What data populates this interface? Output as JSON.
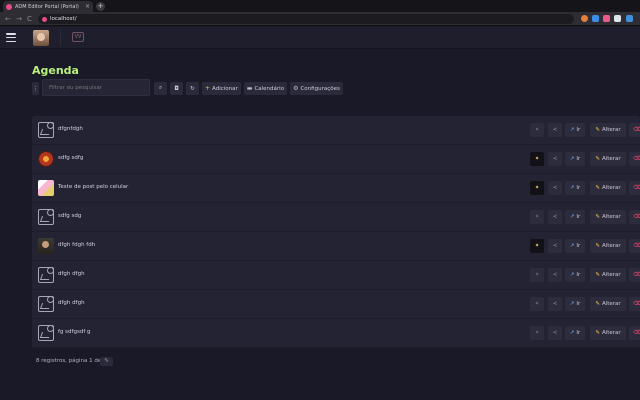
{
  "browser": {
    "tab_title": "ADM Editor Portal (Portal)",
    "tab_close": "×",
    "new_tab": "+",
    "url": "localhost/",
    "back": "←",
    "forward": "→",
    "reload": "C"
  },
  "appbar": {
    "logo_text": "VV"
  },
  "page": {
    "title": "Agenda"
  },
  "filters": {
    "search_placeholder": "Filtrar ou pesquisar",
    "add_label": "Adicionar",
    "calendar_label": "Calendário",
    "settings_label": "Configurações"
  },
  "actions": {
    "go_label": "Ir",
    "edit_label": "Alterar"
  },
  "rows": [
    {
      "title": "dfgnfdgh",
      "thumb": "placeholder",
      "pinned": false
    },
    {
      "title": "sdfg sdfg",
      "thumb": "img-red",
      "pinned": true
    },
    {
      "title": "Teste de post pelo celular",
      "thumb": "img-pink",
      "pinned": true
    },
    {
      "title": "sdfg sdg",
      "thumb": "placeholder",
      "pinned": false
    },
    {
      "title": "dfgh fdgh fdh",
      "thumb": "img-dark",
      "pinned": true
    },
    {
      "title": "dfgh dfgh",
      "thumb": "placeholder",
      "pinned": false
    },
    {
      "title": "dfgh dfgh",
      "thumb": "placeholder",
      "pinned": false
    },
    {
      "title": "fg sdfgsdf g",
      "thumb": "placeholder",
      "pinned": false
    }
  ],
  "pager": {
    "text": "8 registros, página 1 de 1"
  },
  "colors": {
    "background": "#1a1928",
    "accent_title": "#b9f07b",
    "pin_active": "#f2d35b",
    "delete": "#ff4f7a"
  }
}
